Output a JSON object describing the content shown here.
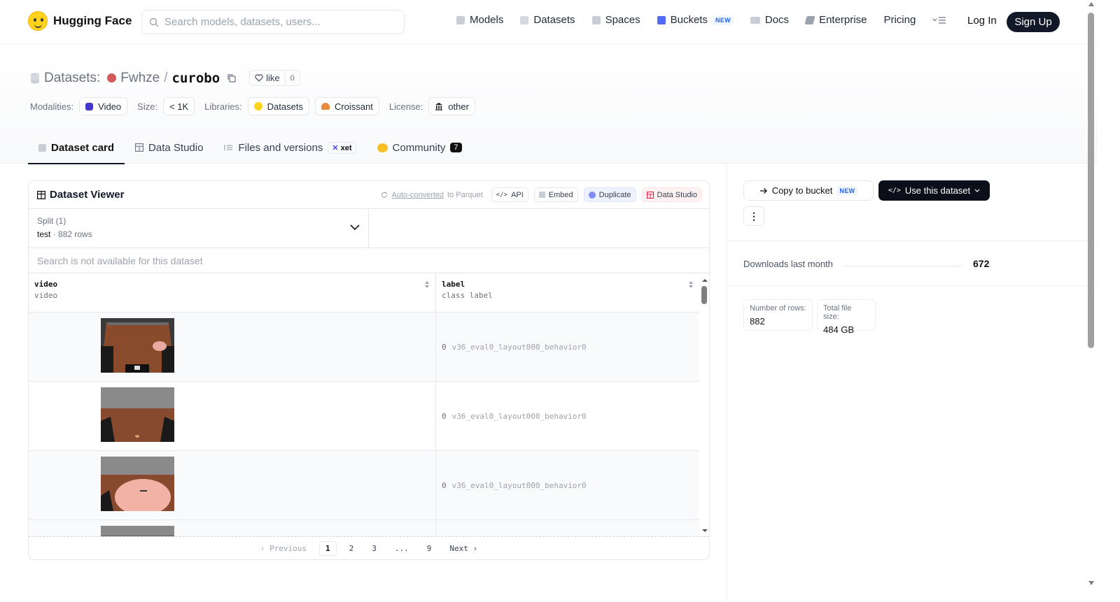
{
  "brand": {
    "name": "Hugging Face"
  },
  "search": {
    "placeholder": "Search models, datasets, users..."
  },
  "nav": {
    "links": [
      {
        "label": "Models",
        "icon": "models-icon"
      },
      {
        "label": "Datasets",
        "icon": "datasets-icon"
      },
      {
        "label": "Spaces",
        "icon": "spaces-icon"
      },
      {
        "label": "Buckets",
        "icon": "buckets-icon",
        "badge": "NEW"
      },
      {
        "label": "Docs",
        "icon": "docs-icon"
      },
      {
        "label": "Enterprise",
        "icon": "enterprise-icon"
      },
      {
        "label": "Pricing"
      }
    ],
    "login": "Log In",
    "signup": "Sign Up"
  },
  "header": {
    "prefix": "Datasets:",
    "owner": "Fwhze",
    "separator": "/",
    "name": "curobo",
    "like_label": "like",
    "like_count": "0"
  },
  "meta": {
    "modalities_label": "Modalities:",
    "modality": "Video",
    "size_label": "Size:",
    "size": "< 1K",
    "libraries_label": "Libraries:",
    "libraries": [
      "Datasets",
      "Croissant"
    ],
    "license_label": "License:",
    "license": "other"
  },
  "tabs": {
    "card": "Dataset card",
    "studio": "Data Studio",
    "files": "Files and versions",
    "xet": "xet",
    "community": "Community",
    "community_count": "7"
  },
  "viewer": {
    "title": "Dataset Viewer",
    "auto_converted": "Auto-converted",
    "to_parquet": " to Parquet",
    "api": "API",
    "embed": "Embed",
    "duplicate": "Duplicate",
    "data_studio": "Data Studio",
    "split_label": "Split (1)",
    "split_value": "test",
    "split_rows": "882 rows",
    "search_na": "Search is not available for this dataset",
    "columns": [
      {
        "name": "video",
        "type": "video"
      },
      {
        "name": "label",
        "type": "class label"
      }
    ],
    "rows": [
      {
        "class_id": "0",
        "label": "v36_eval0_layout000_behavior0"
      },
      {
        "class_id": "0",
        "label": "v36_eval0_layout000_behavior0"
      },
      {
        "class_id": "0",
        "label": "v36_eval0_layout000_behavior0"
      }
    ],
    "pager": {
      "previous": "Previous",
      "pages": [
        "1",
        "2",
        "3",
        "...",
        "9"
      ],
      "current": "1",
      "next": "Next"
    }
  },
  "sidebar": {
    "copy_to_bucket": "Copy to bucket",
    "copy_badge": "NEW",
    "use_dataset": "Use this dataset",
    "downloads_label": "Downloads last month",
    "downloads_value": "672",
    "num_rows_label": "Number of rows:",
    "num_rows_value": "882",
    "file_size_label": "Total file size:",
    "file_size_value": "484 GB"
  },
  "colors": {
    "accent_dark": "#0b0f19",
    "owner_avatar": "#d45959",
    "badge_blue": "#2563eb"
  }
}
